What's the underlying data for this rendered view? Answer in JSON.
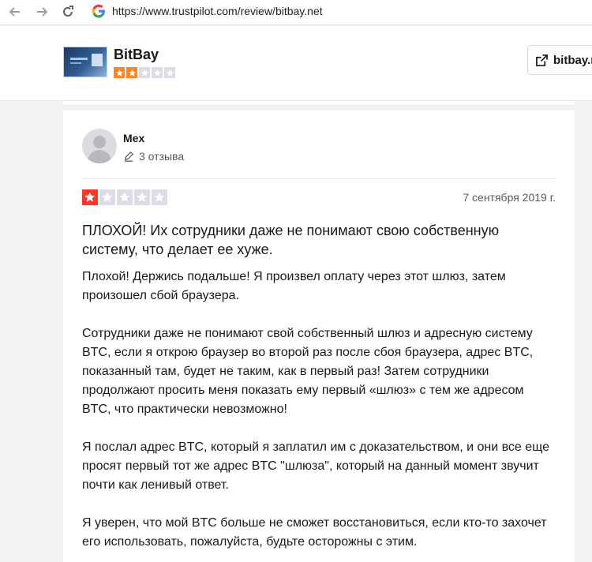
{
  "browser": {
    "url": "https://www.trustpilot.com/review/bitbay.net"
  },
  "company": {
    "name": "BitBay",
    "rating_stars": 2,
    "max_stars": 5,
    "website_label": "bitbay.n"
  },
  "review": {
    "author": "Mex",
    "author_reviews": "3 отзыва",
    "rating_stars": 1,
    "max_stars": 5,
    "date": "7 сентября 2019 г.",
    "title": "ПЛОХОЙ! Их сотрудники даже не понимают свою собственную систему, что делает ее хуже.",
    "paragraphs": [
      "Плохой! Держись подальше! Я произвел оплату через этот шлюз, затем произошел сбой браузера.",
      "Сотрудники даже не понимают свой собственный шлюз и адресную систему BTC, если я открою браузер во второй раз после сбоя браузера, адрес BTC, показанный там, будет не таким, как в первый раз! Затем сотрудники продолжают просить меня показать ему первый «шлюз» с тем же адресом BTC, что практически невозможно!",
      "Я послал адрес BTC, который я заплатил им с доказательством, и они все еще просят первый тот же адрес BTC \"шлюза\", который на данный момент звучит почти как ленивый ответ.",
      "Я уверен, что мой BTC больше не сможет восстановиться, если кто-то захочет его использовать, пожалуйста, будьте осторожны с этим."
    ]
  },
  "colors": {
    "star_one": "#ff3722",
    "star_two": "#ff8622",
    "star_empty": "#dcdce6"
  }
}
